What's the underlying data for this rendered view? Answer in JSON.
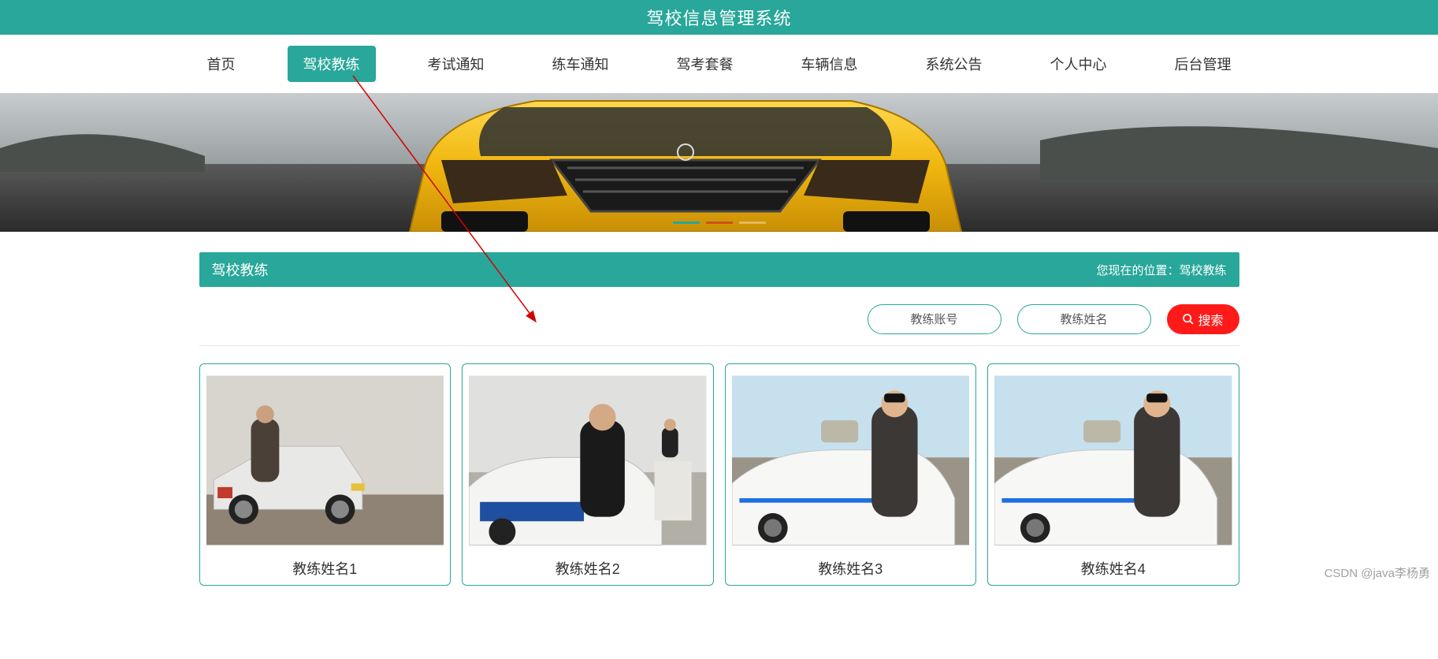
{
  "header": {
    "title": "驾校信息管理系统"
  },
  "nav": {
    "items": [
      {
        "label": "首页",
        "active": false
      },
      {
        "label": "驾校教练",
        "active": true
      },
      {
        "label": "考试通知",
        "active": false
      },
      {
        "label": "练车通知",
        "active": false
      },
      {
        "label": "驾考套餐",
        "active": false
      },
      {
        "label": "车辆信息",
        "active": false
      },
      {
        "label": "系统公告",
        "active": false
      },
      {
        "label": "个人中心",
        "active": false
      },
      {
        "label": "后台管理",
        "active": false
      }
    ]
  },
  "section": {
    "title": "驾校教练",
    "breadcrumb_prefix": "您现在的位置：",
    "breadcrumb_current": "驾校教练"
  },
  "search": {
    "account_placeholder": "教练账号",
    "name_placeholder": "教练姓名",
    "button_label": "搜索"
  },
  "cards": [
    {
      "title": "教练姓名1"
    },
    {
      "title": "教练姓名2"
    },
    {
      "title": "教练姓名3"
    },
    {
      "title": "教练姓名4"
    }
  ],
  "watermark": "CSDN @java李杨勇"
}
